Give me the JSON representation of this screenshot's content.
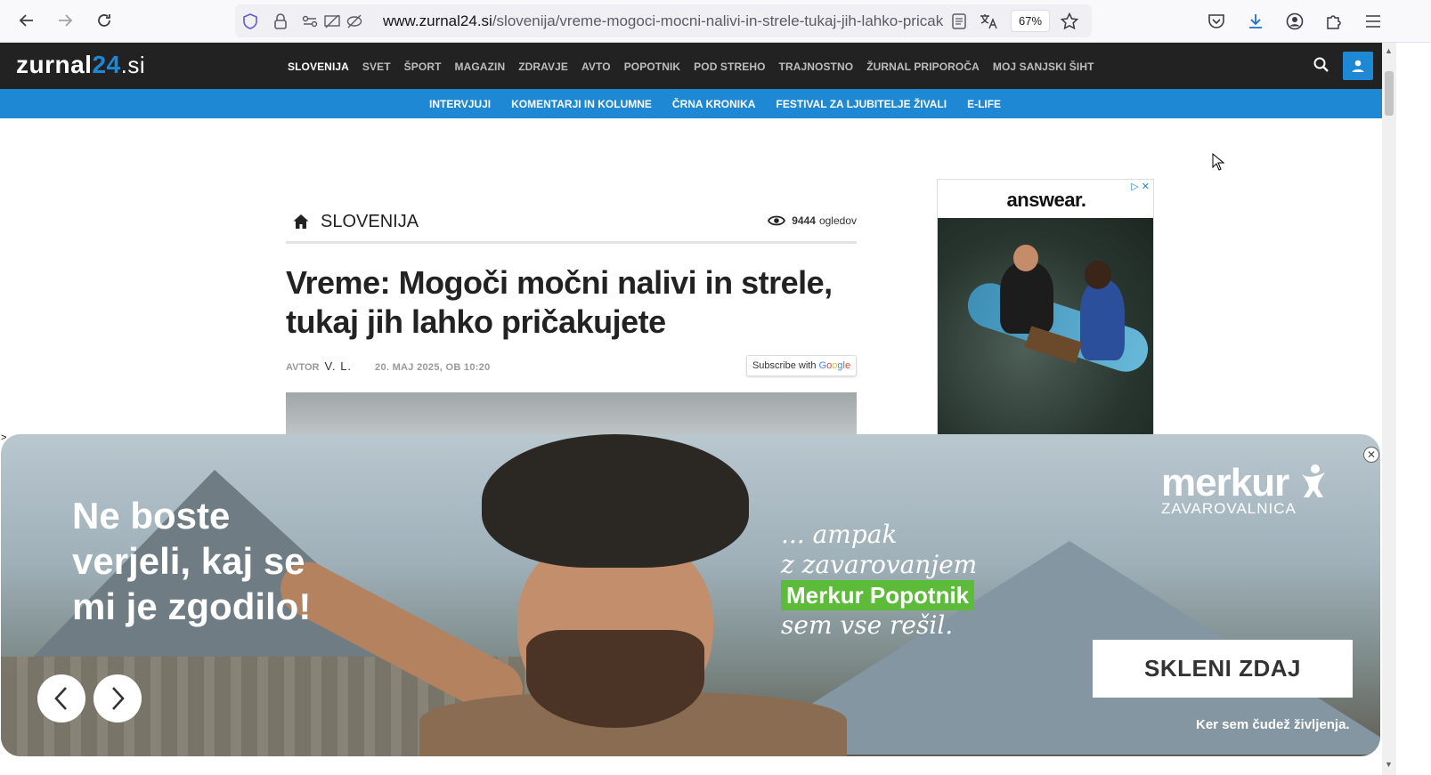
{
  "browser": {
    "url_domain": "www.zurnal24.si",
    "url_path": "/slovenija/vreme-mogoci-mocni-nalivi-in-strele-tukaj-jih-lahko-pricak",
    "zoom": "67%"
  },
  "site": {
    "logo_main": "zurnal",
    "logo_num": "24",
    "logo_tld": ".si",
    "main_nav": [
      "SLOVENIJA",
      "SVET",
      "ŠPORT",
      "MAGAZIN",
      "ZDRAVJE",
      "AVTO",
      "POPOTNIK",
      "POD STREHO",
      "TRAJNOSTNO",
      "ŽURNAL PRIPOROČA",
      "MOJ SANJSKI ŠIHT"
    ],
    "sub_nav": [
      "INTERVJUJI",
      "KOMENTARJI IN KOLUMNE",
      "ČRNA KRONIKA",
      "FESTIVAL ZA LJUBITELJE ŽIVALI",
      "E-LIFE"
    ],
    "accent": "#1e88d4"
  },
  "article": {
    "section": "SLOVENIJA",
    "views_count": "9444",
    "views_label": "ogledov",
    "title": "Vreme: Mogoči močni nalivi in strele, tukaj jih lahko pričakujete",
    "author_label": "AVTOR",
    "author": "V. L.",
    "date": "20. MAJ 2025, OB 10:20",
    "subscribe_prefix": "Subscribe with"
  },
  "side_ad": {
    "brand": "answear."
  },
  "banner_ad": {
    "claim_l1": "Ne boste",
    "claim_l2": "verjeli, kaj se",
    "claim_l3": "mi je zgodilo!",
    "amp_l1": "... ampak",
    "amp_l2": "z zavarovanjem",
    "amp_pill": "Merkur Popotnik",
    "amp_l3": "sem vse rešil.",
    "brand_name": "merkur",
    "brand_sub": "ZAVAROVALNICA",
    "cta": "SKLENI ZDAJ",
    "slogan": "Ker sem čudež življenja."
  }
}
